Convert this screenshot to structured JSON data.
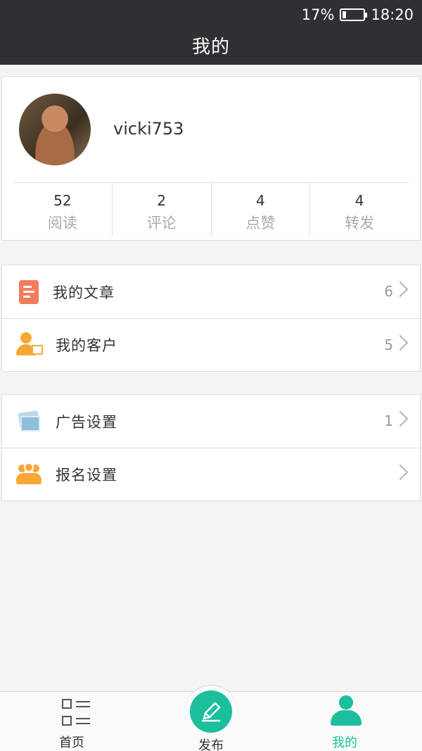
{
  "status_bar": {
    "battery": "17%",
    "time": "18:20",
    "battery_level": 0.17
  },
  "header": {
    "title": "我的"
  },
  "profile": {
    "username": "vicki753",
    "stats": [
      {
        "value": "52",
        "label": "阅读"
      },
      {
        "value": "2",
        "label": "评论"
      },
      {
        "value": "4",
        "label": "点赞"
      },
      {
        "value": "4",
        "label": "转发"
      }
    ]
  },
  "menu_group_1": [
    {
      "label": "我的文章",
      "count": "6",
      "icon": "article-icon",
      "icon_color": "#f27c5d"
    },
    {
      "label": "我的客户",
      "count": "5",
      "icon": "customer-icon",
      "icon_color": "#f6a837"
    }
  ],
  "menu_group_2": [
    {
      "label": "广告设置",
      "count": "1",
      "icon": "ad-settings-icon",
      "icon_color": "#8fbedb"
    },
    {
      "label": "报名设置",
      "count": "",
      "icon": "signup-settings-icon",
      "icon_color": "#f6a837"
    }
  ],
  "bottom_nav": {
    "items": [
      {
        "label": "首页",
        "icon": "home-list-icon",
        "active": false
      },
      {
        "label": "发布",
        "icon": "pencil-icon",
        "active": false
      },
      {
        "label": "我的",
        "icon": "user-icon",
        "active": true
      }
    ],
    "accent_color": "#1bbf9c"
  }
}
